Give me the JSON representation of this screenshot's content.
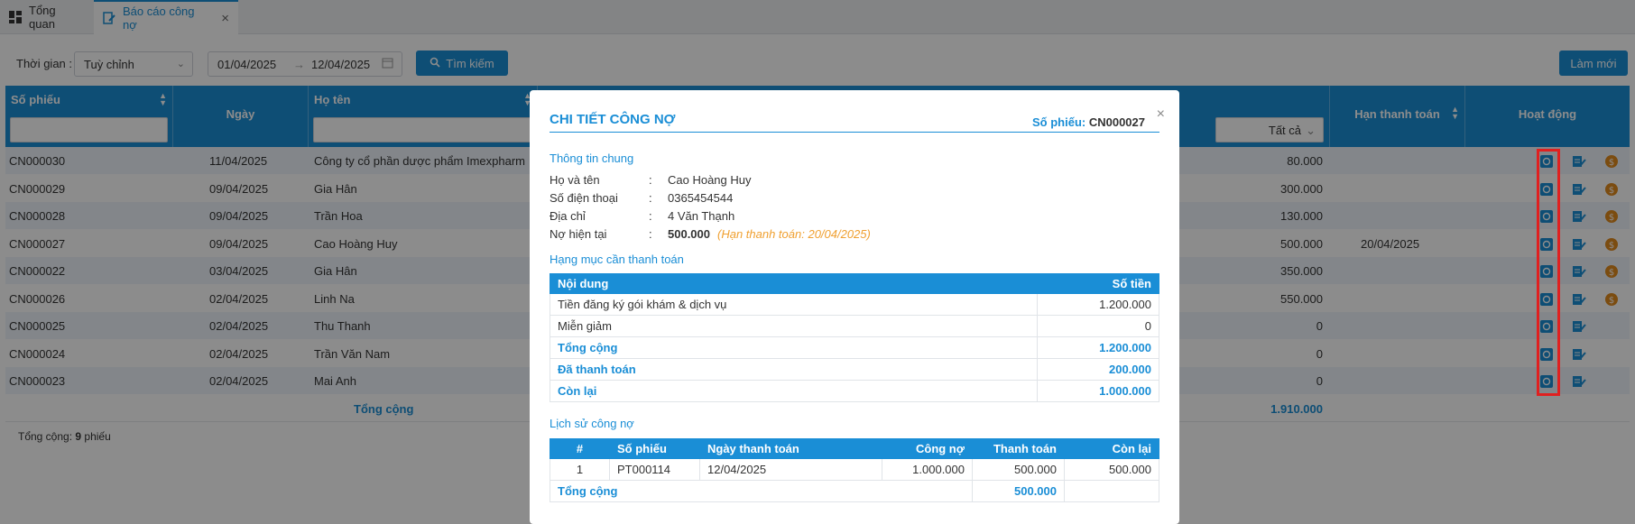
{
  "tabs": [
    {
      "label": "Tổng quan"
    },
    {
      "label": "Báo cáo công nợ"
    }
  ],
  "filter": {
    "time_label": "Thời gian :",
    "time_value": "Tuỳ chỉnh",
    "date_from": "01/04/2025",
    "date_arrow": "→",
    "date_to": "12/04/2025",
    "search_label": "Tìm kiếm",
    "refresh_label": "Làm mới"
  },
  "grid": {
    "headers": {
      "so_phieu": "Số phiếu",
      "ngay": "Ngày",
      "ho_ten": "Họ tên",
      "all_filter": "Tất cả",
      "han_thanh_toan": "Hạn thanh toán",
      "hoat_dong": "Hoạt động"
    },
    "rows": [
      {
        "id": "CN000030",
        "date": "11/04/2025",
        "name": "Công ty cổ phần dược phẩm Imexpharm",
        "amount": "80.000",
        "due": "",
        "pay_icon": true
      },
      {
        "id": "CN000029",
        "date": "09/04/2025",
        "name": "Gia Hân",
        "amount": "300.000",
        "due": "",
        "pay_icon": true
      },
      {
        "id": "CN000028",
        "date": "09/04/2025",
        "name": "Trần Hoa",
        "amount": "130.000",
        "due": "",
        "pay_icon": true
      },
      {
        "id": "CN000027",
        "date": "09/04/2025",
        "name": "Cao Hoàng Huy",
        "amount": "500.000",
        "due": "20/04/2025",
        "pay_icon": true
      },
      {
        "id": "CN000022",
        "date": "03/04/2025",
        "name": "Gia Hân",
        "amount": "350.000",
        "due": "",
        "pay_icon": true
      },
      {
        "id": "CN000026",
        "date": "02/04/2025",
        "name": "Linh Na",
        "amount": "550.000",
        "due": "",
        "pay_icon": true
      },
      {
        "id": "CN000025",
        "date": "02/04/2025",
        "name": "Thu Thanh",
        "amount": "0",
        "due": "",
        "pay_icon": false
      },
      {
        "id": "CN000024",
        "date": "02/04/2025",
        "name": "Trần Văn Nam",
        "amount": "0",
        "due": "",
        "pay_icon": false
      },
      {
        "id": "CN000023",
        "date": "02/04/2025",
        "name": "Mai Anh",
        "amount": "0",
        "due": "",
        "pay_icon": false
      }
    ],
    "total_label": "Tổng cộng",
    "total_value": "1.910.000",
    "footer_prefix": "Tổng cộng: ",
    "footer_count": "9",
    "footer_suffix": " phiếu"
  },
  "modal": {
    "title": "CHI TIẾT CÔNG NỢ",
    "num_label": "Số phiếu:",
    "num_value": "CN000027",
    "close": "×",
    "general_title": "Thông tin chung",
    "info": [
      {
        "k": "Họ và tên",
        "v": "Cao Hoàng Huy",
        "bold": false,
        "note": ""
      },
      {
        "k": "Số điện thoại",
        "v": "0365454544",
        "bold": false,
        "note": ""
      },
      {
        "k": "Địa chỉ",
        "v": "4 Văn Thạnh",
        "bold": false,
        "note": ""
      },
      {
        "k": "Nợ hiện tại",
        "v": "500.000",
        "bold": true,
        "note": "(Hạn thanh toán: 20/04/2025)"
      }
    ],
    "items_title": "Hạng mục cần thanh toán",
    "items_headers": {
      "content": "Nội dung",
      "amount": "Số tiền"
    },
    "items": [
      {
        "content": "Tiền đăng ký gói khám & dịch vụ",
        "amount": "1.200.000"
      },
      {
        "content": "Miễn giảm",
        "amount": "0"
      }
    ],
    "items_summary": [
      {
        "label": "Tổng cộng",
        "value": "1.200.000"
      },
      {
        "label": "Đã thanh toán",
        "value": "200.000"
      },
      {
        "label": "Còn lại",
        "value": "1.000.000"
      }
    ],
    "history_title": "Lịch sử công nợ",
    "history_headers": {
      "idx": "#",
      "num": "Số phiếu",
      "date": "Ngày thanh toán",
      "debt": "Công nợ",
      "paid": "Thanh toán",
      "remain": "Còn lại"
    },
    "history": [
      {
        "idx": "1",
        "num": "PT000114",
        "date": "12/04/2025",
        "debt": "1.000.000",
        "paid": "500.000",
        "remain": "500.000"
      }
    ],
    "history_total_label": "Tổng cộng",
    "history_total_value": "500.000"
  }
}
